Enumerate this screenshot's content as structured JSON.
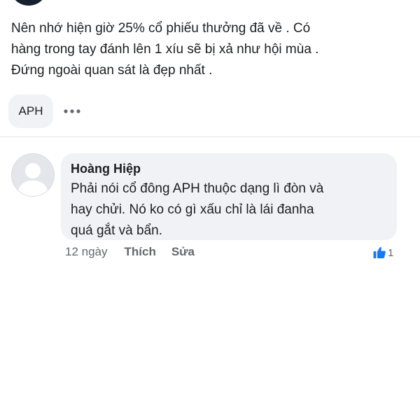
{
  "post": {
    "lines": [
      "Nên nhớ hiện giờ 25% cổ phiếu thưởng đã về . Có",
      "hàng trong tay đánh lên 1 xíu sẽ bị xả như hội mùa .",
      "Đứng ngoài quan sát là đẹp nhất ."
    ],
    "tag": "APH",
    "more_icon": "more-horizontal-icon"
  },
  "comment": {
    "author": "Hoàng Hiệp",
    "lines": [
      "Phải nói cổ đông APH thuộc dạng lì đòn và",
      "hay chửi. Nó ko có gì xấu chỉ là lái đanha",
      "quá gắt và bẩn."
    ],
    "time": "12 ngày",
    "like_label": "Thích",
    "edit_label": "Sửa",
    "reaction_count": "1",
    "reaction_icon": "thumbs-up-icon"
  },
  "colors": {
    "text": "#1c1e21",
    "secondary": "#65676b",
    "bubble": "#f0f2f5",
    "like_blue": "#1877f2"
  }
}
